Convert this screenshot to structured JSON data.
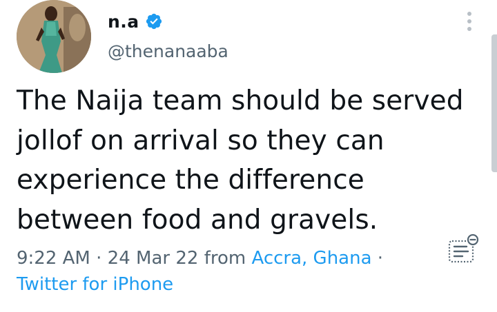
{
  "author": {
    "display_name": "n.a",
    "handle": "@thenanaaba",
    "verified": true
  },
  "tweet": {
    "lines": [
      "The Naija team should be served",
      "jollof on arrival so they can",
      "experience the difference",
      "between food and gravels."
    ]
  },
  "meta": {
    "time": "9:22 AM",
    "sep1": " · ",
    "date": "24 Mar 22",
    "from": " from ",
    "location": "Accra, Ghana",
    "sep2": " ·",
    "source": "Twitter for iPhone"
  },
  "icons": {
    "verified": "verified-badge-icon",
    "more": "more-vertical-icon",
    "summary": "text-summary-icon"
  },
  "colors": {
    "text": "#0f1419",
    "secondary": "#536471",
    "link": "#1d9bf0",
    "verified": "#1d9bf0"
  }
}
